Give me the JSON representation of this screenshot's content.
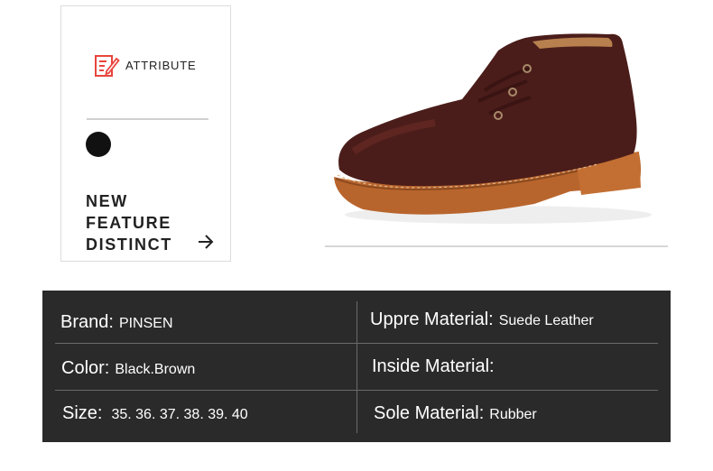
{
  "card": {
    "attribute_label": "ATTRIBUTE",
    "icon": "document-edit-icon",
    "accent_color": "#e8453c",
    "swatch_color": "#111111",
    "feature_lines": [
      "NEW",
      "FEATURE",
      "DISTINCT"
    ],
    "arrow_icon": "arrow-right-icon"
  },
  "product_image": "brown-suede-ankle-boot",
  "specs": {
    "brand": {
      "label": "Brand:",
      "value": "PINSEN"
    },
    "upper": {
      "label": "Uppre Material:",
      "value": "Suede Leather"
    },
    "color": {
      "label": "Color:",
      "value": "Black.Brown"
    },
    "inside": {
      "label": "Inside Material:",
      "value": ""
    },
    "size": {
      "label": "Size:",
      "value": "35. 36. 37. 38. 39. 40"
    },
    "sole": {
      "label": "Sole Material:",
      "value": "Rubber"
    }
  }
}
